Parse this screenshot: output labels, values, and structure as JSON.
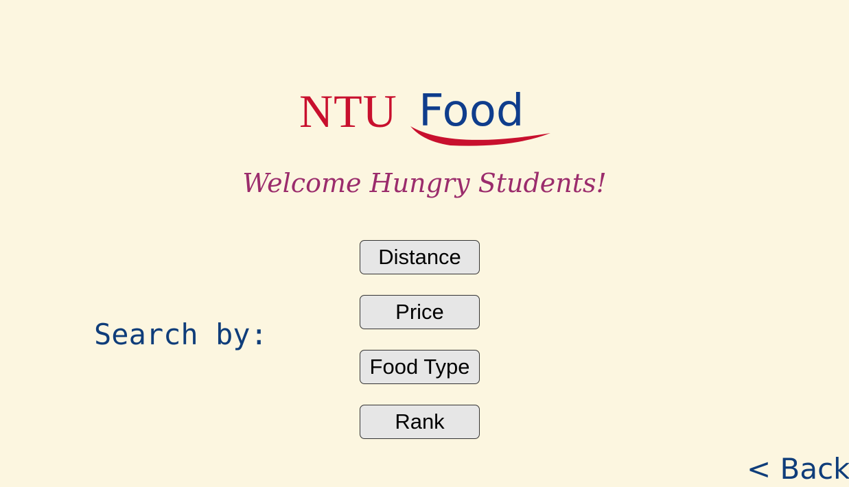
{
  "logo": {
    "part1": "NTU",
    "part2": "Food",
    "colors": {
      "ntu": "#c8102e",
      "food": "#0f3d8c",
      "swoosh": "#c8102e"
    }
  },
  "welcome": "Welcome Hungry Students!",
  "search": {
    "label": "Search by:",
    "options": {
      "distance": "Distance",
      "price": "Price",
      "food_type": "Food Type",
      "rank": "Rank"
    }
  },
  "nav": {
    "back": "< Back"
  },
  "colors": {
    "background": "#fcf6e0",
    "welcome_text": "#9b2c6c",
    "label_text": "#0f3d7a",
    "button_bg": "#e6e6e6"
  }
}
